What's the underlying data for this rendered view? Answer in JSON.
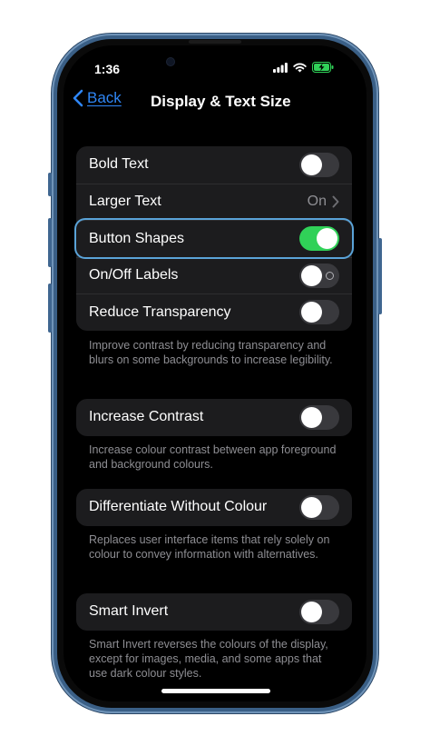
{
  "status": {
    "time": "1:36"
  },
  "nav": {
    "back_label": "Back",
    "title": "Display & Text Size"
  },
  "group1": {
    "rows": [
      {
        "label": "Bold Text",
        "toggle": "off"
      },
      {
        "label": "Larger Text",
        "value": "On"
      },
      {
        "label": "Button Shapes",
        "toggle": "on"
      },
      {
        "label": "On/Off Labels",
        "toggle": "off"
      },
      {
        "label": "Reduce Transparency",
        "toggle": "off"
      }
    ],
    "footer": "Improve contrast by reducing transparency and blurs on some backgrounds to increase legibility."
  },
  "group2": {
    "label": "Increase Contrast",
    "toggle": "off",
    "footer": "Increase colour contrast between app foreground and background colours."
  },
  "group3": {
    "label": "Differentiate Without Colour",
    "toggle": "off",
    "footer": "Replaces user interface items that rely solely on colour to convey information with alternatives."
  },
  "group4": {
    "label": "Smart Invert",
    "toggle": "off",
    "footer": "Smart Invert reverses the colours of the display, except for images, media, and some apps that use dark colour styles."
  },
  "colors": {
    "accent": "#2f86f5",
    "toggle_on": "#30d158",
    "frame": "#3a5f86"
  }
}
